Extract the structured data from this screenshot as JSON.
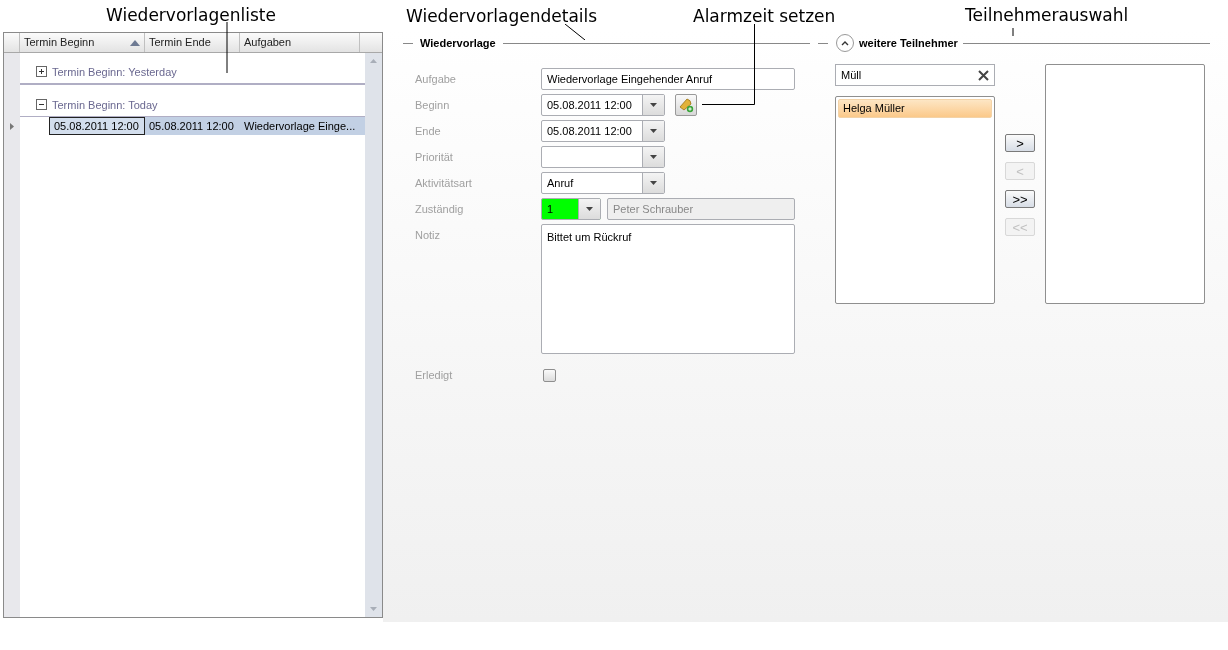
{
  "annotations": [
    {
      "text": "Wiedervorlagenliste"
    },
    {
      "text": "Wiedervorlagendetails"
    },
    {
      "text": "Alarmzeit setzen"
    },
    {
      "text": "Teilnehmerauswahl"
    }
  ],
  "grid": {
    "columns": [
      {
        "label": "Termin Beginn",
        "sorted": true
      },
      {
        "label": "Termin Ende",
        "sorted": false
      },
      {
        "label": "Aufgaben",
        "sorted": false
      }
    ],
    "groups": [
      {
        "label": "Termin Beginn: Yesterday",
        "expanded": false
      },
      {
        "label": "Termin Beginn: Today",
        "expanded": true,
        "rows": [
          {
            "cells": [
              "05.08.2011 12:00",
              "05.08.2011 12:00",
              "Wiedervorlage Einge..."
            ],
            "selected": true
          }
        ]
      }
    ]
  },
  "details": {
    "title": "Wiedervorlage",
    "fields": [
      {
        "kind": "text",
        "label": "Aufgabe",
        "value": "Wiedervorlage Eingehender Anruf"
      },
      {
        "kind": "combo",
        "label": "Beginn",
        "value": "05.08.2011 12:00",
        "alarm": true
      },
      {
        "kind": "combo",
        "label": "Ende",
        "value": "05.08.2011 12:00",
        "alarm": false
      },
      {
        "kind": "combo",
        "label": "Priorität",
        "alarm": false
      },
      {
        "kind": "combo",
        "label": "Aktivitätsart",
        "value": "Anruf",
        "alarm": false
      },
      {
        "kind": "assignee",
        "label": "Zuständig",
        "value": "1",
        "color": "#00ff00",
        "name": "Peter Schrauber"
      },
      {
        "kind": "textarea",
        "label": "Notiz",
        "value": "Bittet um Rückruf"
      },
      {
        "kind": "checkbox",
        "label": "Erledigt",
        "checked": false
      }
    ]
  },
  "participants": {
    "title": "weitere Teilnehmer",
    "expanded": true,
    "search": "Müll",
    "available": [
      {
        "name": "Helga Müller",
        "selected": true
      }
    ],
    "buttons": [
      {
        "label": ">",
        "disabled": false
      },
      {
        "label": "<",
        "disabled": true
      },
      {
        "label": ">>",
        "disabled": false
      },
      {
        "label": "<<",
        "disabled": true
      }
    ]
  }
}
